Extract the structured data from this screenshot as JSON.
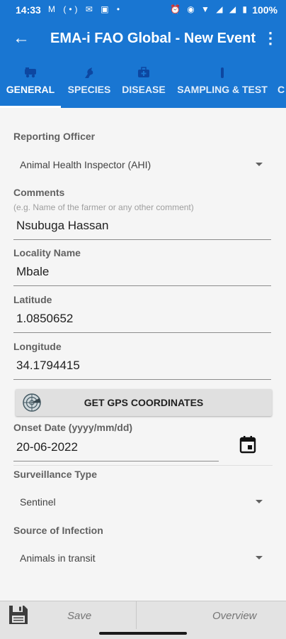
{
  "status_bar": {
    "time": "14:33",
    "battery": "100%",
    "left_icons": "M (•) ✉ ▣ •",
    "right_icons": "⏰ ◉ ▼ ◢ ◢ ▮"
  },
  "app_bar": {
    "back_icon": "←",
    "title": "EMA-i FAO Global - New Event",
    "menu_icon": "⋮"
  },
  "tabs": [
    {
      "label": "GENERAL",
      "icon": "truck-icon",
      "active": true
    },
    {
      "label": "SPECIES",
      "icon": "bird-icon",
      "active": false
    },
    {
      "label": "DISEASE",
      "icon": "medical-kit-icon",
      "active": false
    },
    {
      "label": "SAMPLING & TEST",
      "icon": "test-tube-icon",
      "active": false
    },
    {
      "label": "C",
      "icon": "",
      "active": false
    }
  ],
  "form": {
    "reporting_officer": {
      "label": "Reporting Officer",
      "value": "Animal Health Inspector (AHI)"
    },
    "comments": {
      "label": "Comments",
      "hint": "(e.g. Name of the farmer or any other comment)",
      "value": "Nsubuga Hassan"
    },
    "locality": {
      "label": "Locality Name",
      "value": "Mbale"
    },
    "latitude": {
      "label": "Latitude",
      "value": "1.0850652"
    },
    "longitude": {
      "label": "Longitude",
      "value": "34.1794415"
    },
    "gps_button": {
      "label": "GET GPS COORDINATES"
    },
    "onset_date": {
      "label": "Onset Date (yyyy/mm/dd)",
      "value": "20-06-2022"
    },
    "surveillance_type": {
      "label": "Surveillance Type",
      "value": "Sentinel"
    },
    "source_of_infection": {
      "label": "Source of Infection",
      "value": "Animals in transit"
    }
  },
  "bottom_bar": {
    "save_label": "Save",
    "overview_label": "Overview"
  },
  "colors": {
    "primary": "#1976d2",
    "form_background": "#f5f5f5",
    "bottom_bar": "#e3e3e3"
  }
}
